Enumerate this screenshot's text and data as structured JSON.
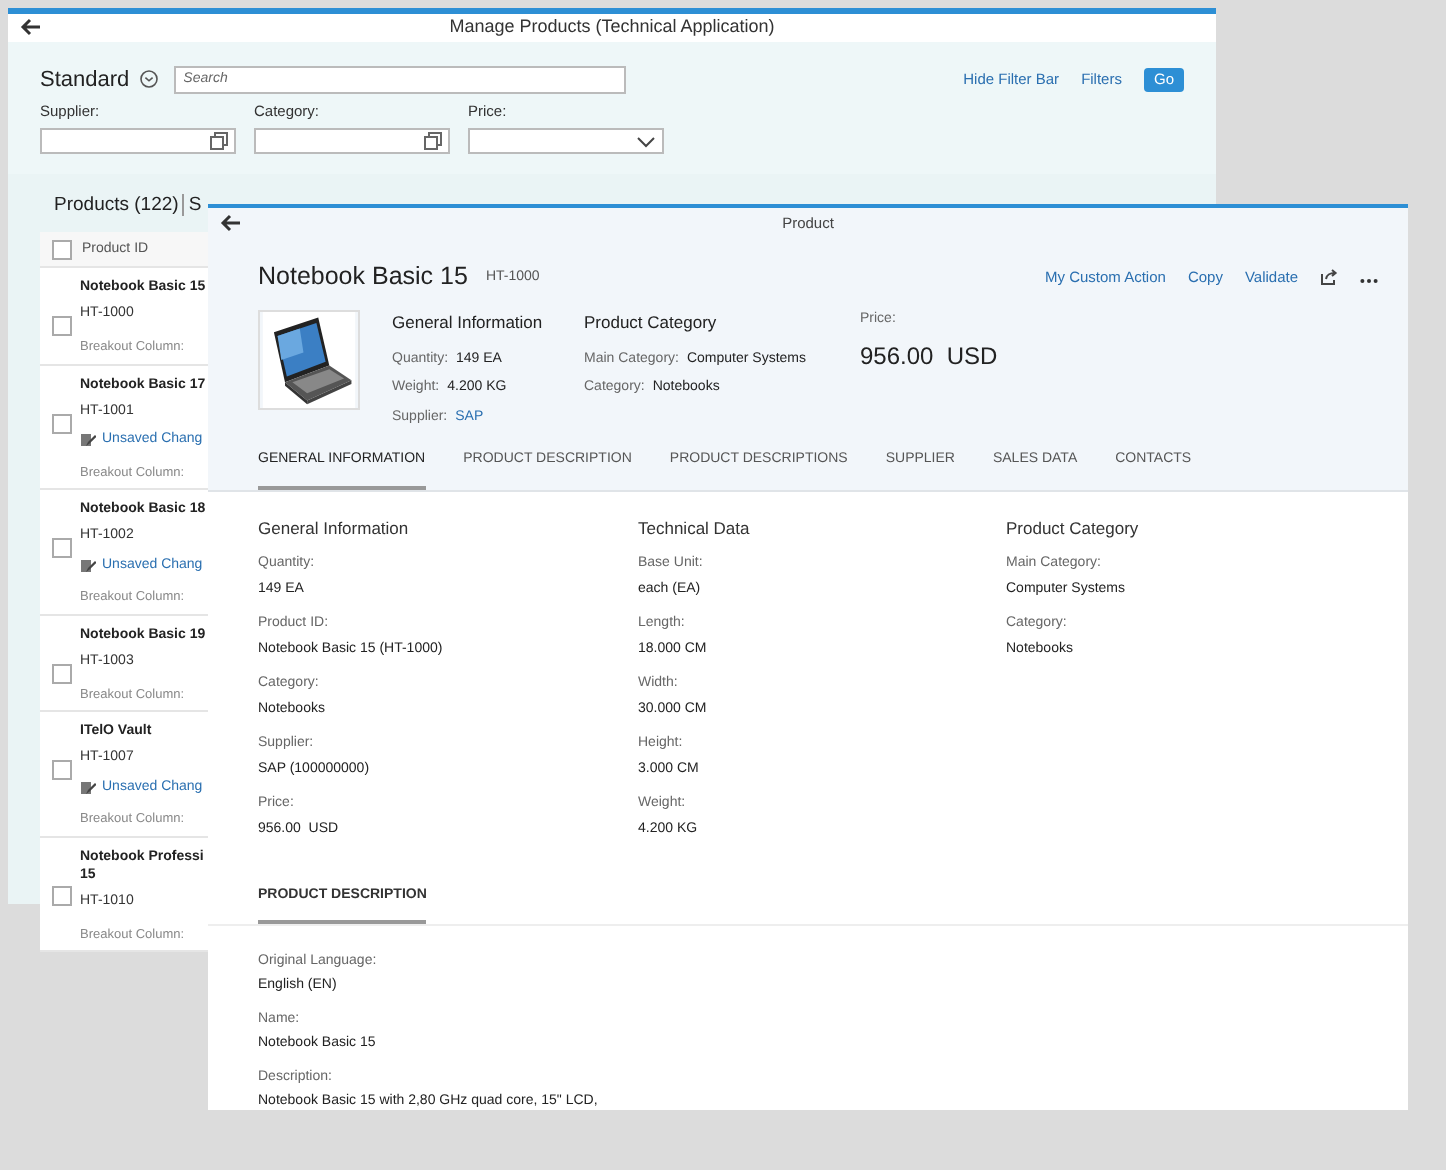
{
  "background_window": {
    "title": "Manage Products (Technical Application)",
    "filter_bar": {
      "variant": "Standard",
      "search": {
        "placeholder": "Search"
      },
      "links": [
        "Hide Filter Bar",
        "Filters"
      ],
      "go_button": "Go",
      "fields": [
        {
          "label": "Supplier:",
          "kind": "value_help"
        },
        {
          "label": "Category:",
          "kind": "value_help"
        },
        {
          "label": "Price:",
          "kind": "dropdown"
        }
      ]
    },
    "table": {
      "title": "Products (122)",
      "next_tab": "S",
      "column": "Product ID",
      "header_checked": false,
      "rows": [
        {
          "name_lines": [
            "Notebook Basic 15"
          ],
          "id": "HT-1000",
          "checked": false,
          "breakout": "Breakout Column:"
        },
        {
          "name_lines": [
            "Notebook Basic 17"
          ],
          "id": "HT-1001",
          "checked": false,
          "unsaved": "Unsaved Chang",
          "breakout": "Breakout Column:"
        },
        {
          "name_lines": [
            "Notebook Basic 18"
          ],
          "id": "HT-1002",
          "checked": false,
          "unsaved": "Unsaved Chang",
          "breakout": "Breakout Column:"
        },
        {
          "name_lines": [
            "Notebook Basic 19"
          ],
          "id": "HT-1003",
          "checked": false,
          "breakout": "Breakout Column:"
        },
        {
          "name_lines": [
            "ITelO Vault"
          ],
          "id": "HT-1007",
          "checked": false,
          "unsaved": "Unsaved Chang",
          "breakout": "Breakout Column:"
        },
        {
          "name_lines": [
            "Notebook Professi",
            "15"
          ],
          "id": "HT-1010",
          "checked": false,
          "breakout": "Breakout Column:"
        }
      ]
    }
  },
  "dialog": {
    "title": "Product",
    "object_title": "Notebook Basic 15",
    "object_id": "HT-1000",
    "actions": [
      "My Custom Action",
      "Copy",
      "Validate"
    ],
    "header_groups": [
      {
        "title": "General Information",
        "fields": [
          {
            "label": "Quantity:",
            "value": "149 EA",
            "kind": "text"
          },
          {
            "label": "Weight:",
            "value": "4.200 KG",
            "kind": "text"
          },
          {
            "label": "Supplier:",
            "value": "SAP",
            "kind": "link"
          }
        ]
      },
      {
        "title": "Product Category",
        "fields": [
          {
            "label": "Main Category:",
            "value": "Computer Systems",
            "kind": "text"
          },
          {
            "label": "Category:",
            "value": "Notebooks",
            "kind": "text"
          }
        ]
      }
    ],
    "price": {
      "label": "Price:",
      "value": "956.00  USD"
    },
    "tabs": [
      {
        "label": "GENERAL INFORMATION",
        "selected": true
      },
      {
        "label": "PRODUCT DESCRIPTION",
        "selected": false
      },
      {
        "label": "PRODUCT DESCRIPTIONS",
        "selected": false
      },
      {
        "label": "SUPPLIER",
        "selected": false
      },
      {
        "label": "SALES DATA",
        "selected": false
      },
      {
        "label": "CONTACTS",
        "selected": false
      }
    ],
    "columns": [
      {
        "title": "General Information",
        "fields": [
          {
            "label": "Quantity:",
            "value": "149 EA"
          },
          {
            "label": "Product ID:",
            "value": "Notebook Basic 15 (HT-1000)"
          },
          {
            "label": "Category:",
            "value": "Notebooks"
          },
          {
            "label": "Supplier:",
            "value": "SAP (100000000)"
          },
          {
            "label": "Price:",
            "value": "956.00  USD"
          }
        ]
      },
      {
        "title": "Technical Data",
        "fields": [
          {
            "label": "Base Unit:",
            "value": "each (EA)"
          },
          {
            "label": "Length:",
            "value": "18.000 CM"
          },
          {
            "label": "Width:",
            "value": "30.000 CM"
          },
          {
            "label": "Height:",
            "value": "3.000 CM"
          },
          {
            "label": "Weight:",
            "value": "4.200 KG"
          }
        ]
      },
      {
        "title": "Product Category",
        "fields": [
          {
            "label": "Main Category:",
            "value": "Computer Systems"
          },
          {
            "label": "Category:",
            "value": "Notebooks"
          }
        ]
      }
    ],
    "description": {
      "title": "PRODUCT DESCRIPTION",
      "fields": [
        {
          "label": "Original Language:",
          "value": "English (EN)"
        },
        {
          "label": "Name:",
          "value": "Notebook Basic 15"
        },
        {
          "label": "Description:",
          "value": "Notebook Basic 15 with 2,80 GHz quad core, 15\" LCD,"
        }
      ]
    }
  }
}
